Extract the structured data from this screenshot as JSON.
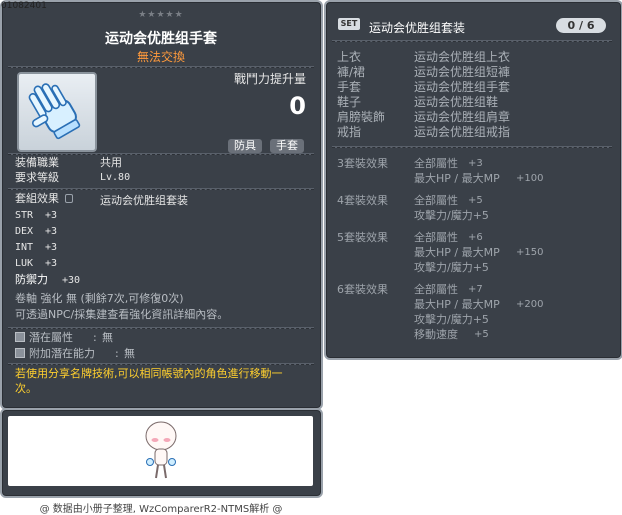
{
  "item_id": "01082401",
  "stars": "★★★★★",
  "title": "运动会优胜组手套",
  "trade": "無法交換",
  "power": {
    "label": "戰鬥力提升量",
    "value": "0"
  },
  "tags": [
    "防具",
    "手套"
  ],
  "job": {
    "label": "装備職業",
    "value": "共用"
  },
  "level": {
    "label": "要求等級",
    "value": "Lv.80"
  },
  "set_effect": {
    "label": "套組效果",
    "value": "运动会优胜组套装"
  },
  "stats": [
    {
      "name": "STR",
      "value": "+3"
    },
    {
      "name": "DEX",
      "value": "+3"
    },
    {
      "name": "INT",
      "value": "+3"
    },
    {
      "name": "LUK",
      "value": "+3"
    }
  ],
  "defense": {
    "label": "防禦力",
    "value": "+30"
  },
  "scroll_line": "卷軸 強化 無 (剩餘7次,可修復0次)",
  "npc_line": "可透過NPC/採集建查看強化資訊詳細內容。",
  "potential": {
    "label": "潛在屬性",
    "sep": ":",
    "value": "無"
  },
  "bonus_potential": {
    "label": "附加潛在能力",
    "sep": ":",
    "value": "無"
  },
  "note_line1": "若使用分享名牌技術,可以相同帳號內的角色進行移動一",
  "note_line2": "次。",
  "footer": "@ 数据由小册子整理, WzComparerR2-NTMS解析 @",
  "set_panel": {
    "badge": "SET",
    "name": "运动会优胜组套装",
    "count": "0 / 6",
    "pieces": [
      {
        "slot": "上衣",
        "item": "运动会优胜组上衣"
      },
      {
        "slot": "褲/裙",
        "item": "运动会优胜组短褲"
      },
      {
        "slot": "手套",
        "item": "运动会优胜组手套"
      },
      {
        "slot": "鞋子",
        "item": "运动会优胜组鞋"
      },
      {
        "slot": "肩膀裝飾",
        "item": "运动会优胜组肩章"
      },
      {
        "slot": "戒指",
        "item": "运动会优胜组戒指"
      }
    ],
    "effects": [
      {
        "title": "3套裝效果",
        "lines": [
          {
            "text": "全部屬性",
            "value": "+3"
          },
          {
            "text": "最大HP / 最大MP",
            "value": "+100"
          }
        ]
      },
      {
        "title": "4套裝效果",
        "lines": [
          {
            "text": "全部屬性",
            "value": "+5"
          },
          {
            "text": "攻擊力/魔力+5",
            "value": ""
          }
        ]
      },
      {
        "title": "5套裝效果",
        "lines": [
          {
            "text": "全部屬性",
            "value": "+6"
          },
          {
            "text": "最大HP / 最大MP",
            "value": "+150"
          },
          {
            "text": "攻擊力/魔力+5",
            "value": ""
          }
        ]
      },
      {
        "title": "6套裝效果",
        "lines": [
          {
            "text": "全部屬性",
            "value": "+7"
          },
          {
            "text": "最大HP / 最大MP",
            "value": "+200"
          },
          {
            "text": "攻擊力/魔力+5",
            "value": ""
          },
          {
            "text": "移動速度",
            "value": "+5"
          }
        ]
      }
    ]
  }
}
